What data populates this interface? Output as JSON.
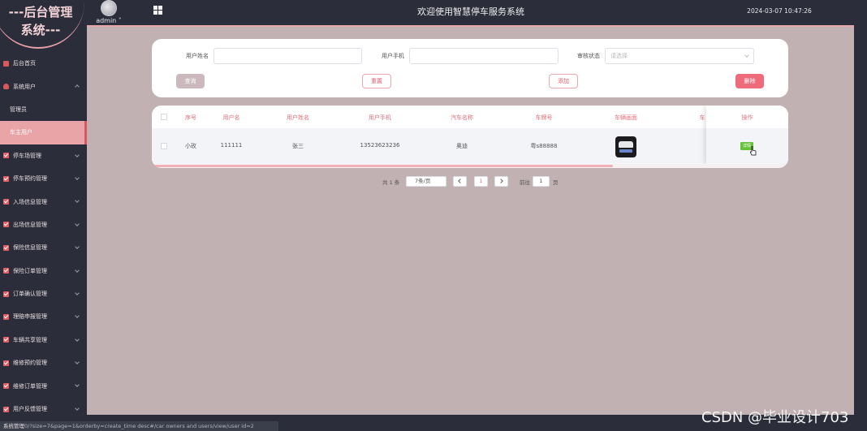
{
  "header": {
    "brand_line1": "---后台管理",
    "brand_line2": "系统---",
    "user_name": "admin",
    "system_title": "欢迎使用智慧停车服务系统",
    "datetime": "2024-03-07 10:47:26"
  },
  "sidebar": {
    "items": [
      {
        "label": "后台首页"
      },
      {
        "label": "系统用户"
      },
      {
        "label": "管理员"
      },
      {
        "label": "车主用户"
      },
      {
        "label": "停车场管理"
      },
      {
        "label": "停车预约管理"
      },
      {
        "label": "入场信息管理"
      },
      {
        "label": "出场信息管理"
      },
      {
        "label": "保险信息管理"
      },
      {
        "label": "保险订单管理"
      },
      {
        "label": "订单确认管理"
      },
      {
        "label": "理赔申报管理"
      },
      {
        "label": "车辆共享管理"
      },
      {
        "label": "维修预约管理"
      },
      {
        "label": "维修订单管理"
      },
      {
        "label": "用户反馈管理"
      }
    ]
  },
  "search": {
    "name_label": "用户姓名",
    "phone_label": "用户手机",
    "status_label": "审核状态",
    "status_placeholder": "请选择",
    "search_button": "查询",
    "reset_button": "重置",
    "add_button": "添加",
    "delete_button": "删除"
  },
  "table": {
    "columns": [
      "序号",
      "用户名",
      "用户姓名",
      "用户手机",
      "汽车名称",
      "车牌号",
      "车辆画面",
      "车",
      "操作"
    ],
    "rows": [
      {
        "index": "小玫",
        "username": "111111",
        "realname": "张三",
        "phone": "13523623236",
        "car_name": "奥迪",
        "plate": "粤s88888",
        "action": "详情"
      }
    ]
  },
  "pagination": {
    "total": "共 1 条",
    "page_size": "7条/页",
    "current_page": "1",
    "goto_label": "前往",
    "goto_value": "1",
    "page_suffix": "页"
  },
  "statusbar": {
    "url": "0/?size=7&page=1&orderby=create_time desc#/car owners and users/view/user id=2",
    "overlay_label": "系统管理"
  },
  "watermark": "CSDN @毕业设计703"
}
